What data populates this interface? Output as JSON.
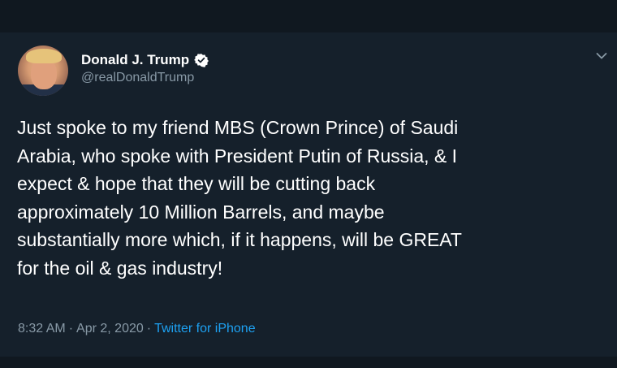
{
  "tweet": {
    "display_name": "Donald J. Trump",
    "handle": "@realDonaldTrump",
    "verified": true,
    "text": "Just spoke to my friend MBS (Crown Prince) of Saudi\nArabia, who spoke with President Putin of Russia, & I\nexpect & hope that they will be cutting back\napproximately 10 Million Barrels, and maybe\nsubstantially more which, if it happens, will be GREAT\nfor the oil & gas industry!",
    "time": "8:32 AM",
    "date": "Apr 2, 2020",
    "separator": "·",
    "source": "Twitter for iPhone"
  },
  "colors": {
    "background": "#15202b",
    "text": "#ffffff",
    "secondary_text": "#8899a6",
    "link": "#1da1f2",
    "verified_badge": "#ffffff"
  },
  "icons": {
    "verified": "verified-badge-icon",
    "more": "chevron-down-icon"
  }
}
